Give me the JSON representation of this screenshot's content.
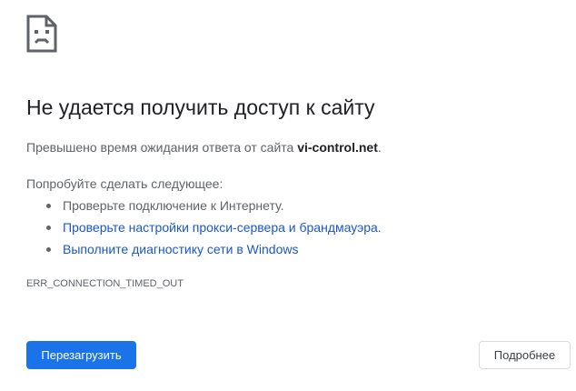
{
  "icon": {
    "name": "sad-page-icon"
  },
  "heading": "Не удается получить доступ к сайту",
  "description": {
    "prefix": "Превышено время ожидания ответа от сайта ",
    "domain": "vi-control.net",
    "suffix": "."
  },
  "suggestions": {
    "heading": "Попробуйте сделать следующее:",
    "items": [
      {
        "label": "Проверьте подключение к Интернету.",
        "is_link": false
      },
      {
        "label": "Проверьте настройки прокси-сервера и брандмауэра.",
        "is_link": true
      },
      {
        "label": "Выполните диагностику сети в Windows",
        "is_link": true
      }
    ]
  },
  "error_code": "ERR_CONNECTION_TIMED_OUT",
  "buttons": {
    "reload_label": "Перезагрузить",
    "details_label": "Подробнее"
  },
  "colors": {
    "primary_button": "#1a73e8",
    "link": "#1a57c7",
    "text_secondary": "#5f6368",
    "text_primary": "#202124"
  }
}
